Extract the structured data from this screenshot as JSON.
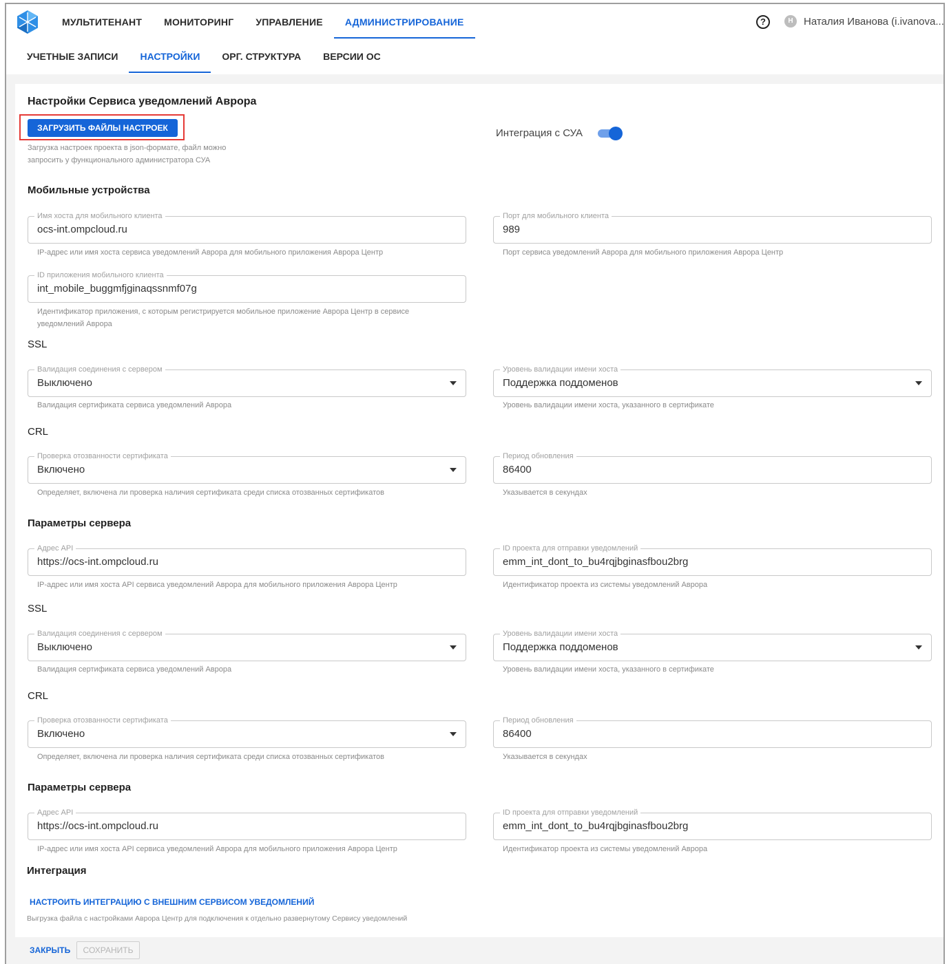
{
  "header": {
    "nav": [
      "МУЛЬТИТЕНАНТ",
      "МОНИТОРИНГ",
      "УПРАВЛЕНИЕ",
      "АДМИНИСТРИРОВАНИЕ"
    ],
    "help_icon": "?",
    "user_initial": "Н",
    "user_name": "Наталия Иванова (i.ivanova..."
  },
  "tabs": [
    "УЧЕТНЫЕ ЗАПИСИ",
    "НАСТРОЙКИ",
    "ОРГ. СТРУКТУРА",
    "ВЕРСИИ ОС"
  ],
  "page": {
    "title": "Настройки Сервиса уведомлений Аврора",
    "upload_button": "ЗАГРУЗИТЬ ФАЙЛЫ НАСТРОЕК",
    "upload_hint_1": "Загрузка настроек проекта в json-формате, файл можно",
    "upload_hint_2": "запросить у функционального администратора СУА",
    "integration_toggle_label": "Интеграция с СУА",
    "integration_toggle_on": true
  },
  "mobile": {
    "title": "Мобильные устройства",
    "host": {
      "label": "Имя хоста для мобильного клиента",
      "value": "ocs-int.ompcloud.ru",
      "hint": "IP-адрес или имя хоста сервиса уведомлений Аврора для мобильного приложения Аврора Центр"
    },
    "port": {
      "label": "Порт для мобильного клиента",
      "value": "989",
      "hint": "Порт сервиса уведомлений Аврора для мобильного приложения Аврора Центр"
    },
    "app_id": {
      "label": "ID приложения мобильного клиента",
      "value": "int_mobile_buggmfjginaqssnmf07g",
      "hint_1": "Идентификатор приложения, с которым регистрируется мобильное приложение Аврора Центр в сервисе",
      "hint_2": "уведомлений Аврора"
    },
    "ssl": {
      "title": "SSL",
      "validation": {
        "label": "Валидация соединения с сервером",
        "value": "Выключено",
        "hint": "Валидация сертификата сервиса уведомлений Аврора"
      },
      "host_level": {
        "label": "Уровень валидации имени хоста",
        "value": "Поддержка поддоменов",
        "hint": "Уровень валидации имени хоста, указанного в сертификате"
      }
    },
    "crl": {
      "title": "CRL",
      "check": {
        "label": "Проверка отозванности сертификата",
        "value": "Включено",
        "hint": "Определяет, включена ли проверка наличия сертификата среди списка отозванных сертификатов"
      },
      "period": {
        "label": "Период обновления",
        "value": "86400",
        "hint": "Указывается в секундах"
      }
    }
  },
  "server1": {
    "title": "Параметры сервера",
    "api": {
      "label": "Адрес API",
      "value": "https://ocs-int.ompcloud.ru",
      "hint": "IP-адрес или имя хоста API сервиса уведомлений Аврора для мобильного приложения Аврора Центр"
    },
    "project": {
      "label": "ID проекта для отправки уведомлений",
      "value": "emm_int_dont_to_bu4rqjbginasfbou2brg",
      "hint": "Идентификатор проекта из системы уведомлений Аврора"
    },
    "ssl": {
      "title": "SSL",
      "validation": {
        "label": "Валидация соединения с сервером",
        "value": "Выключено",
        "hint": "Валидация сертификата сервиса уведомлений Аврора"
      },
      "host_level": {
        "label": "Уровень валидации имени хоста",
        "value": "Поддержка поддоменов",
        "hint": "Уровень валидации имени хоста, указанного в сертификате"
      }
    },
    "crl": {
      "title": "CRL",
      "check": {
        "label": "Проверка отозванности сертификата",
        "value": "Включено",
        "hint": "Определяет, включена ли проверка наличия сертификата среди списка отозванных сертификатов"
      },
      "period": {
        "label": "Период обновления",
        "value": "86400",
        "hint": "Указывается в секундах"
      }
    }
  },
  "server2": {
    "title": "Параметры сервера",
    "api": {
      "label": "Адрес API",
      "value": "https://ocs-int.ompcloud.ru",
      "hint": "IP-адрес или имя хоста API сервиса уведомлений Аврора для мобильного приложения Аврора Центр"
    },
    "project": {
      "label": "ID проекта для отправки уведомлений",
      "value": "emm_int_dont_to_bu4rqjbginasfbou2brg",
      "hint": "Идентификатор проекта из системы уведомлений Аврора"
    }
  },
  "integration": {
    "title": "Интеграция",
    "link": "НАСТРОИТЬ ИНТЕГРАЦИЮ С ВНЕШНИМ СЕРВИСОМ УВЕДОМЛЕНИЙ",
    "hint": "Выгрузка файла с настройками Аврора Центр для подключения к отдельно развернутому Сервису уведомлений"
  },
  "footer": {
    "close": "ЗАКРЫТЬ",
    "save": "СОХРАНИТЬ"
  },
  "colors": {
    "accent": "#1565d8",
    "highlight_border": "#e53935",
    "background": "#f3f3f3"
  }
}
